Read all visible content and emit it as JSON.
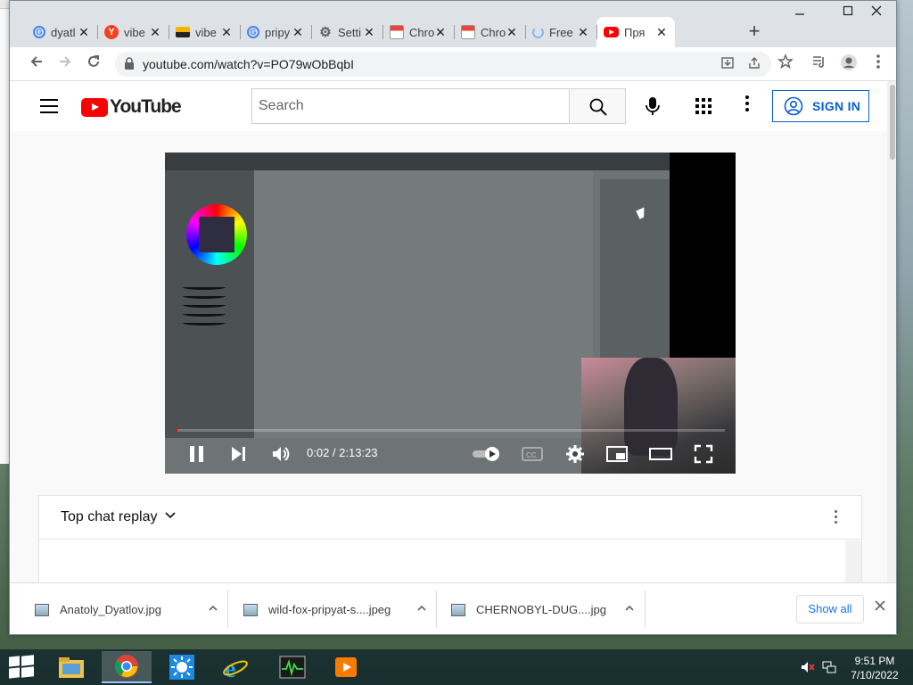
{
  "browser": {
    "tabs": [
      {
        "title": "dyatl",
        "favicon": "google-g-icon",
        "active": false
      },
      {
        "title": "vibe",
        "favicon": "yandex-icon",
        "active": false
      },
      {
        "title": "vibe",
        "favicon": "image-icon",
        "active": false
      },
      {
        "title": "pripy",
        "favicon": "google-g-icon",
        "active": false
      },
      {
        "title": "Setti",
        "favicon": "gear-icon",
        "active": false
      },
      {
        "title": "Chro",
        "favicon": "store-icon",
        "active": false
      },
      {
        "title": "Chro",
        "favicon": "store-icon",
        "active": false
      },
      {
        "title": "Free",
        "favicon": "loading-icon",
        "active": false
      },
      {
        "title": "Пря",
        "favicon": "youtube-icon",
        "active": true
      }
    ],
    "new_tab_label": "+",
    "url": "youtube.com/watch?v=PO79wObBqbI",
    "close_glyph": "✕"
  },
  "youtube": {
    "logo_text": "YouTube",
    "search_placeholder": "Search",
    "sign_in_label": "SIGN IN",
    "player": {
      "time_current": "0:02",
      "time_separator": " / ",
      "time_total": "2:13:23",
      "progress_fraction": 0.0003
    },
    "chat": {
      "title": "Top chat replay",
      "caret": "⌄"
    }
  },
  "downloads": {
    "items": [
      {
        "filename": "Anatoly_Dyatlov.jpg"
      },
      {
        "filename": "wild-fox-pripyat-s....jpeg"
      },
      {
        "filename": "CHERNOBYL-DUG....jpg"
      }
    ],
    "show_all_label": "Show all",
    "chevron": "^"
  },
  "taskbar": {
    "clock_time": "9:51 PM",
    "clock_date": "7/10/2022"
  },
  "colors": {
    "youtube_red": "#ff0000",
    "link_blue": "#065fd4",
    "chrome_tabbar": "#dee1e6"
  }
}
